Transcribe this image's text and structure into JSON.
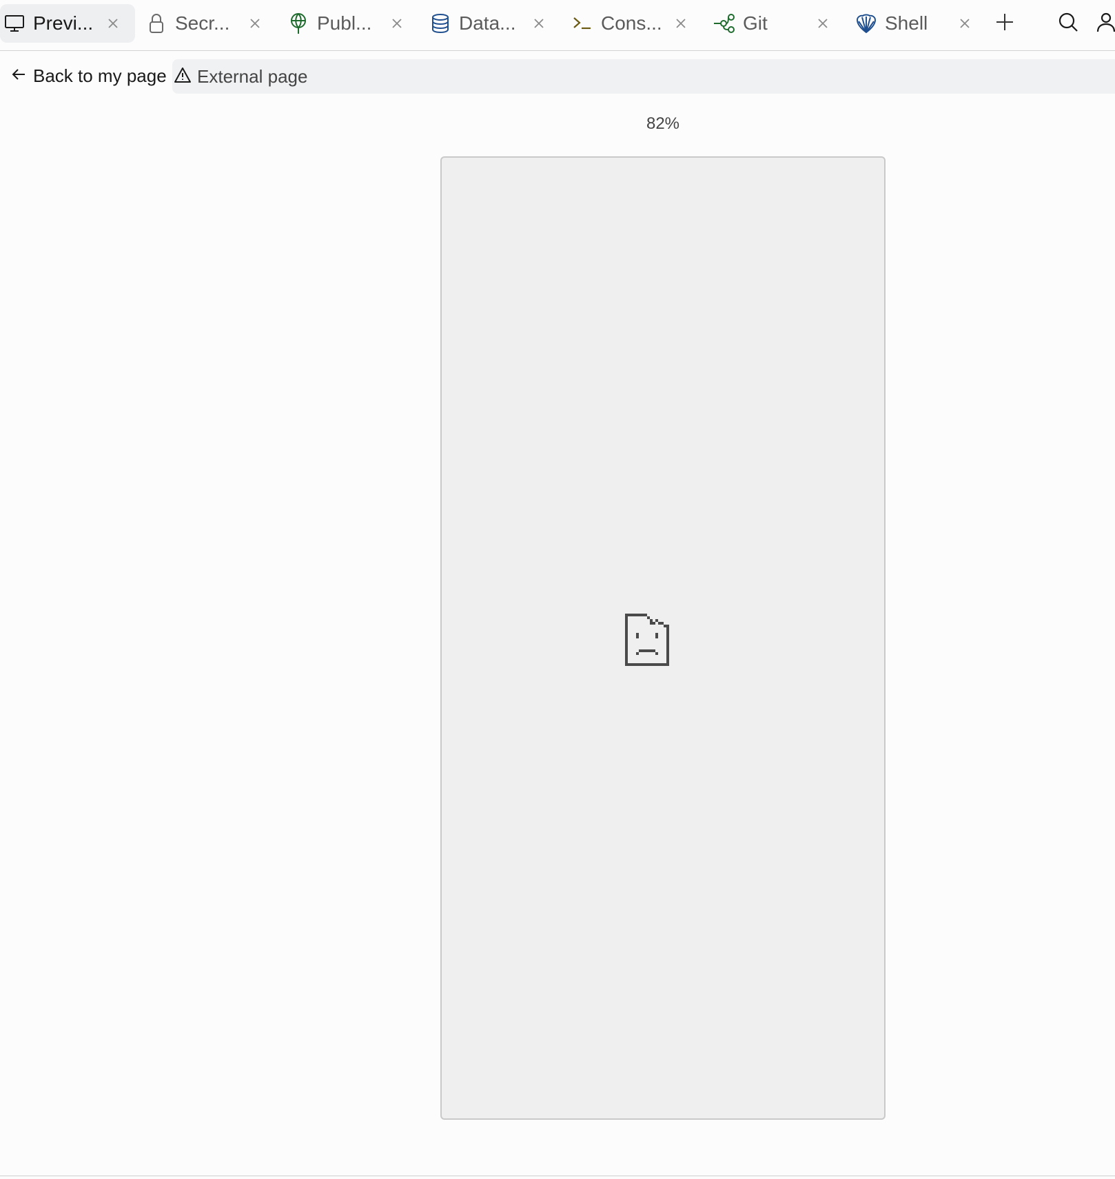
{
  "tabs": [
    {
      "label": "Previ...",
      "icon": "monitor-icon",
      "active": true
    },
    {
      "label": "Secr...",
      "icon": "lock-icon",
      "active": false
    },
    {
      "label": "Publ...",
      "icon": "globe-pin-icon",
      "active": false
    },
    {
      "label": "Data...",
      "icon": "database-icon",
      "active": false
    },
    {
      "label": "Cons...",
      "icon": "terminal-icon",
      "active": false
    },
    {
      "label": "Git",
      "icon": "git-branch-icon",
      "active": false
    },
    {
      "label": "Shell",
      "icon": "shell-icon",
      "active": false
    }
  ],
  "toolbar": {
    "new_tab_icon": "plus-icon",
    "search_icon": "search-icon",
    "user_icon": "user-icon"
  },
  "subbar": {
    "back_label": "Back to my page",
    "external_label": "External page"
  },
  "preview": {
    "zoom_label": "82%",
    "error_icon": "sad-document-icon"
  },
  "colors": {
    "tab_active_bg": "#eeeff1",
    "publ_icon": "#1f6b2e",
    "data_icon": "#1f4f8f",
    "cons_icon": "#6b5a12",
    "git_icon": "#1f6b2e",
    "shell_icon": "#1f4f8f"
  }
}
